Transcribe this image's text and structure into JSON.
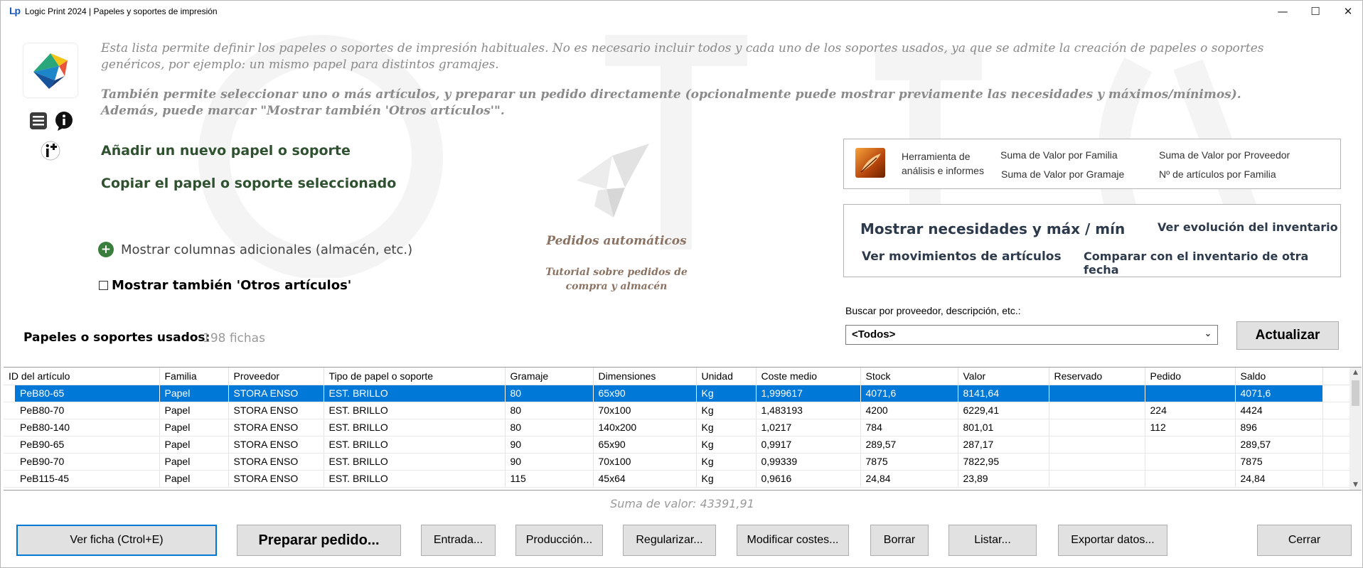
{
  "titlebar": {
    "logo": "Lp",
    "title": "Logic Print 2024 | Papeles y soportes de impresión",
    "minimize": "—",
    "maximize": "☐",
    "close": "✕"
  },
  "description": {
    "line1": "Esta lista permite definir los papeles o soportes de impresión habituales. No es necesario incluir todos y cada uno de los soportes usados, ya que se admite la creación de papeles o soportes genéricos, por ejemplo: un mismo papel para distintos gramajes.",
    "line2": "También permite seleccionar uno o más artículos, y preparar un pedido directamente (opcionalmente puede mostrar previamente las necesidades y máximos/mínimos). Además, puede marcar \"Mostrar también 'Otros artículos'\"."
  },
  "actions": {
    "add_new": "Añadir un nuevo papel o soporte",
    "copy_selected": "Copiar el papel o soporte seleccionado",
    "extra_columns": "Mostrar columnas adicionales (almacén, etc.)",
    "show_others": "Mostrar también 'Otros artículos'"
  },
  "auto_orders": {
    "title": "Pedidos automáticos",
    "tutorial": "Tutorial sobre pedidos de compra y almacén"
  },
  "analysis": {
    "tool_label": "Herramienta de análisis e informes",
    "links": [
      "Suma de Valor por Familia",
      "Suma de Valor por Gramaje",
      "Suma de Valor por Proveedor",
      "Nº de artículos por Familia"
    ]
  },
  "needs": {
    "show_needs": "Mostrar necesidades y máx / mín",
    "movements": "Ver movimientos de artículos",
    "inventory_evolution": "Ver evolución del inventario",
    "compare_inventory": "Comparar con el inventario de otra fecha"
  },
  "search": {
    "label": "Buscar por proveedor, descripción, etc.:",
    "value": "<Todos>",
    "update_button": "Actualizar"
  },
  "list": {
    "title": "Papeles o soportes usados:",
    "count": "198 fichas"
  },
  "table": {
    "columns": [
      "ID del artículo",
      "Familia",
      "Proveedor",
      "Tipo de papel o soporte",
      "Gramaje",
      "Dimensiones",
      "Unidad",
      "Coste medio",
      "Stock",
      "Valor",
      "Reservado",
      "Pedido",
      "Saldo"
    ],
    "rows": [
      [
        "PeB80-65",
        "Papel",
        "STORA ENSO",
        "EST. BRILLO",
        "80",
        "65x90",
        "Kg",
        "1,999617",
        "4071,6",
        "8141,64",
        "",
        "",
        "4071,6"
      ],
      [
        "PeB80-70",
        "Papel",
        "STORA ENSO",
        "EST. BRILLO",
        "80",
        "70x100",
        "Kg",
        "1,483193",
        "4200",
        "6229,41",
        "",
        "224",
        "4424"
      ],
      [
        "PeB80-140",
        "Papel",
        "STORA ENSO",
        "EST. BRILLO",
        "80",
        "140x200",
        "Kg",
        "1,0217",
        "784",
        "801,01",
        "",
        "112",
        "896"
      ],
      [
        "PeB90-65",
        "Papel",
        "STORA ENSO",
        "EST. BRILLO",
        "90",
        "65x90",
        "Kg",
        "0,9917",
        "289,57",
        "287,17",
        "",
        "",
        "289,57"
      ],
      [
        "PeB90-70",
        "Papel",
        "STORA ENSO",
        "EST. BRILLO",
        "90",
        "70x100",
        "Kg",
        "0,99339",
        "7875",
        "7822,95",
        "",
        "",
        "7875"
      ],
      [
        "PeB115-45",
        "Papel",
        "STORA ENSO",
        "EST. BRILLO",
        "115",
        "45x64",
        "Kg",
        "0,9616",
        "24,84",
        "23,89",
        "",
        "",
        "24,84"
      ]
    ]
  },
  "summary": {
    "sum_value": "Suma de valor: 43391,91"
  },
  "buttons": {
    "view": "Ver ficha  (Ctrol+E)",
    "prepare_order": "Preparar pedido...",
    "entry": "Entrada...",
    "production": "Producción...",
    "regularize": "Regularizar...",
    "modify_costs": "Modificar costes...",
    "delete": "Borrar",
    "list": "Listar...",
    "export": "Exportar datos...",
    "close": "Cerrar"
  },
  "colors": {
    "selection": "#0078d7",
    "link_green": "#2f5130",
    "accent_brown": "#8b7363"
  }
}
